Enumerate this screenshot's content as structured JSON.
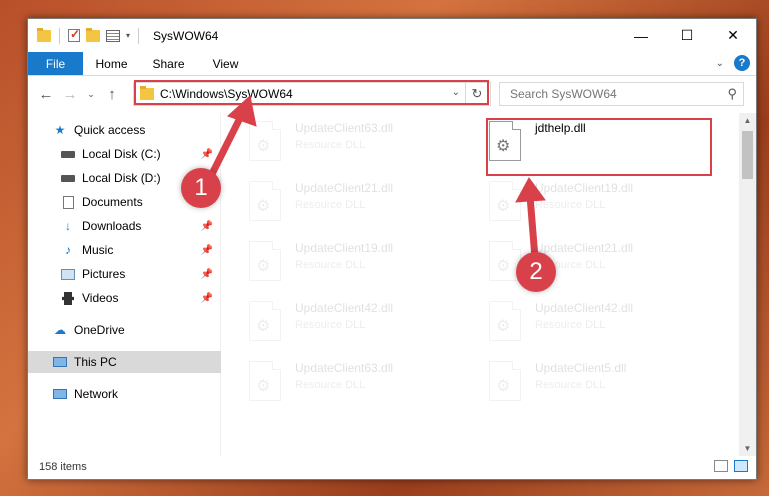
{
  "titlebar": {
    "title": "SysWOW64",
    "minimize": "—",
    "maximize": "☐",
    "close": "✕"
  },
  "ribbon": {
    "tabs": [
      "File",
      "Home",
      "Share",
      "View"
    ],
    "help": "?"
  },
  "nav": {
    "address": "C:\\Windows\\SysWOW64",
    "search_placeholder": "Search SysWOW64"
  },
  "sidebar": {
    "items": [
      {
        "label": "Quick access",
        "icon": "star-icon"
      },
      {
        "label": "Local Disk (C:)",
        "icon": "drive-icon"
      },
      {
        "label": "Local Disk (D:)",
        "icon": "drive-icon"
      },
      {
        "label": "Documents",
        "icon": "documents-icon"
      },
      {
        "label": "Downloads",
        "icon": "download-icon"
      },
      {
        "label": "Music",
        "icon": "music-icon"
      },
      {
        "label": "Pictures",
        "icon": "pictures-icon"
      },
      {
        "label": "Videos",
        "icon": "videos-icon"
      },
      {
        "label": "OneDrive",
        "icon": "cloud-icon"
      },
      {
        "label": "This PC",
        "icon": "computer-icon"
      },
      {
        "label": "Network",
        "icon": "network-icon"
      }
    ]
  },
  "files": {
    "highlighted": {
      "name": "jdthelp.dll"
    },
    "ghost": [
      {
        "name": "UpdateClient63.dll",
        "type": "Resource DLL"
      },
      {
        "name": "UpdateClient21.dll",
        "type": "Resource DLL"
      },
      {
        "name": "UpdateClient19.dll",
        "type": "Resource DLL"
      },
      {
        "name": "UpdateClient19.dll",
        "type": "Resource DLL"
      },
      {
        "name": "UpdateClient21.dll",
        "type": "Resource DLL"
      },
      {
        "name": "UpdateClient42.dll",
        "type": "Resource DLL"
      },
      {
        "name": "UpdateClient42.dll",
        "type": "Resource DLL"
      },
      {
        "name": "UpdateClient63.dll",
        "type": "Resource DLL"
      },
      {
        "name": "UpdateClient5.dll",
        "type": "Resource DLL"
      }
    ]
  },
  "status": {
    "item_count": "158 items"
  },
  "annotations": {
    "badge1": "1",
    "badge2": "2",
    "color": "#d9414a"
  }
}
